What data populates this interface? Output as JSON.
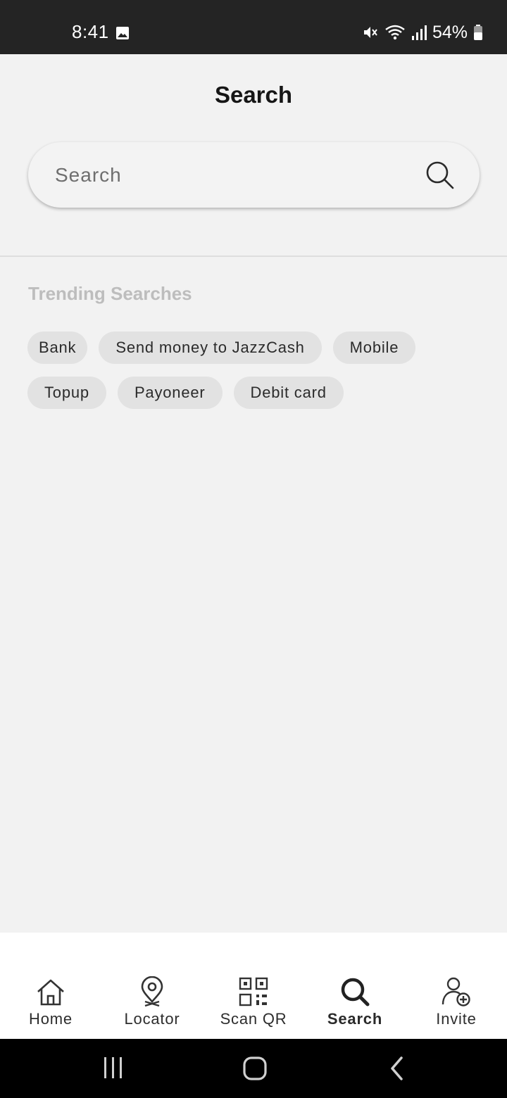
{
  "status_bar": {
    "time": "8:41",
    "battery": "54%",
    "icons": [
      "image-icon",
      "mute-icon",
      "wifi-icon",
      "signal-icon",
      "battery-icon"
    ]
  },
  "header": {
    "title": "Search"
  },
  "search": {
    "placeholder": "Search",
    "value": ""
  },
  "trending": {
    "title": "Trending Searches",
    "chips": [
      "Bank",
      "Send money to JazzCash",
      "Mobile",
      "Topup",
      "Payoneer",
      "Debit card"
    ]
  },
  "bottom_nav": {
    "items": [
      {
        "label": "Home",
        "icon": "home-icon",
        "active": false
      },
      {
        "label": "Locator",
        "icon": "location-pin-icon",
        "active": false
      },
      {
        "label": "Scan QR",
        "icon": "qr-code-icon",
        "active": false
      },
      {
        "label": "Search",
        "icon": "search-icon",
        "active": true
      },
      {
        "label": "Invite",
        "icon": "add-user-icon",
        "active": false
      }
    ]
  },
  "colors": {
    "status_bar_bg": "#242424",
    "page_bg": "#f2f2f2",
    "chip_bg": "#e2e2e2",
    "section_title": "#bdbdbd",
    "nav_bg": "#ffffff",
    "system_nav_bg": "#000000"
  }
}
